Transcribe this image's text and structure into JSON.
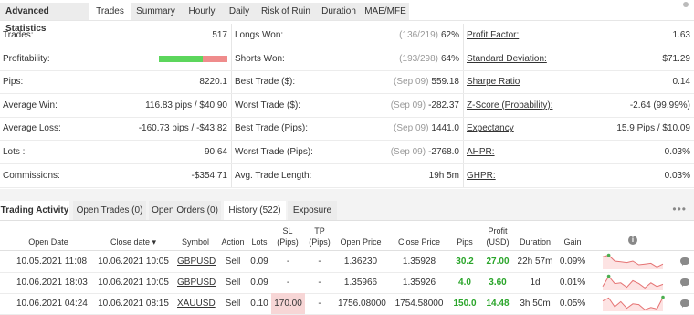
{
  "tabs": [
    "Advanced Statistics",
    "Trades",
    "Summary",
    "Hourly",
    "Daily",
    "Risk of Ruin",
    "Duration",
    "MAE/MFE"
  ],
  "active_tab": "Trades",
  "stats": {
    "col1": [
      {
        "label": "Trades:",
        "value": "517"
      },
      {
        "label": "Profitability:",
        "value": "",
        "bar": {
          "green_fraction": 0.64,
          "green": "#5cd65c",
          "red": "#ef8c8c"
        }
      },
      {
        "label": "Pips:",
        "value": "8220.1"
      },
      {
        "label": "Average Win:",
        "value": "116.83 pips / $40.90"
      },
      {
        "label": "Average Loss:",
        "value": "-160.73 pips / -$43.82"
      },
      {
        "label": "Lots :",
        "value": "90.64"
      },
      {
        "label": "Commissions:",
        "value": "-$354.71"
      }
    ],
    "col2": [
      {
        "label": "Longs Won:",
        "muted": "(136/219)",
        "value": "62%"
      },
      {
        "label": "Shorts Won:",
        "muted": "(193/298)",
        "value": "64%"
      },
      {
        "label": "Best Trade ($):",
        "muted": "(Sep 09)",
        "value": "559.18"
      },
      {
        "label": "Worst Trade ($):",
        "muted": "(Sep 09)",
        "value": "-282.37"
      },
      {
        "label": "Best Trade (Pips):",
        "muted": "(Sep 09)",
        "value": "1441.0"
      },
      {
        "label": "Worst Trade (Pips):",
        "muted": "(Sep 09)",
        "value": "-2768.0"
      },
      {
        "label": "Avg. Trade Length:",
        "muted": "",
        "value": "19h 5m"
      }
    ],
    "col3": [
      {
        "label": "Profit Factor:",
        "value": "1.63"
      },
      {
        "label": "Standard Deviation:",
        "value": "$71.29"
      },
      {
        "label": "Sharpe Ratio",
        "value": "0.14"
      },
      {
        "label": "Z-Score (Probability):",
        "value": "-2.64 (99.99%)"
      },
      {
        "label": "Expectancy",
        "value": "15.9 Pips / $10.09"
      },
      {
        "label": "AHPR:",
        "value": "0.03%"
      },
      {
        "label": "GHPR:",
        "value": "0.03%"
      }
    ]
  },
  "activity": {
    "tabs": [
      "Trading Activity",
      "Open Trades (0)",
      "Open Orders (0)",
      "History (522)",
      "Exposure"
    ],
    "active_tab": "History (522)",
    "more": "•••",
    "headers": {
      "open_date": "Open Date",
      "close_date": "Close date ▾",
      "symbol": "Symbol",
      "action": "Action",
      "lots": "Lots",
      "sl1": "SL",
      "sl2": "(Pips)",
      "tp1": "TP",
      "tp2": "(Pips)",
      "open_price": "Open Price",
      "close_price": "Close Price",
      "pips": "Pips",
      "profit1": "Profit",
      "profit2": "(USD)",
      "duration": "Duration",
      "gain": "Gain",
      "info": "i"
    },
    "rows": [
      {
        "open_date": "10.05.2021 11:08",
        "close_date": "10.06.2021 10:05",
        "symbol": "GBPUSD",
        "action": "Sell",
        "lots": "0.09",
        "sl": "-",
        "tp": "-",
        "open_price": "1.36230",
        "close_price": "1.35928",
        "pips": "30.2",
        "profit": "27.00",
        "duration": "22h 57m",
        "gain": "0.09%",
        "sl_highlight": false
      },
      {
        "open_date": "10.06.2021 18:03",
        "close_date": "10.06.2021 10:05",
        "symbol": "GBPUSD",
        "action": "Sell",
        "lots": "0.09",
        "sl": "-",
        "tp": "-",
        "open_price": "1.35966",
        "close_price": "1.35926",
        "pips": "4.0",
        "profit": "3.60",
        "duration": "1d",
        "gain": "0.01%",
        "sl_highlight": false
      },
      {
        "open_date": "10.06.2021 04:24",
        "close_date": "10.06.2021 08:15",
        "symbol": "XAUUSD",
        "action": "Sell",
        "lots": "0.10",
        "sl": "170.00",
        "tp": "-",
        "open_price": "1756.08000",
        "close_price": "1754.58000",
        "pips": "150.0",
        "profit": "14.48",
        "duration": "3h 50m",
        "gain": "0.05%",
        "sl_highlight": true
      }
    ]
  },
  "colors": {
    "green": "#2aa52a",
    "sparkline": "#e57373",
    "sparkdot": "#4caf50"
  }
}
